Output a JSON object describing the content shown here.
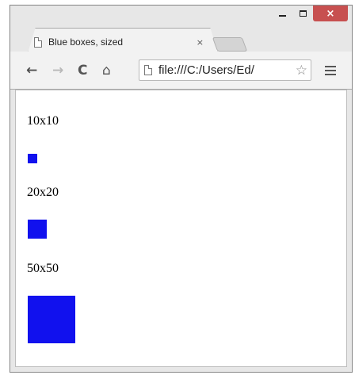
{
  "tab": {
    "title": "Blue boxes, sized",
    "close_glyph": "×"
  },
  "toolbar": {
    "back_glyph": "←",
    "forward_glyph": "→",
    "reload_glyph": "C",
    "home_glyph": "⌂",
    "url": "file:///C:/Users/Ed/",
    "star_glyph": "☆"
  },
  "window_controls": {
    "close_glyph": "×"
  },
  "content": {
    "boxes": [
      {
        "label": "10x10",
        "size": 10
      },
      {
        "label": "20x20",
        "size": 20
      },
      {
        "label": "50x50",
        "size": 50
      }
    ],
    "box_color": "#1111ee"
  },
  "colors": {
    "close_button": "#c75050"
  }
}
